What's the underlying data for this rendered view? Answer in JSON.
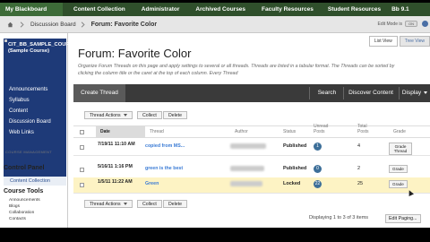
{
  "top_tabs": [
    "My Blackboard",
    "Content Collection",
    "Administrator",
    "Archived Courses",
    "Faculty Resources",
    "Student Resources",
    "Bb 9.1"
  ],
  "breadcrumb": {
    "parent": "Discussion Board",
    "current": "Forum: Favorite Color"
  },
  "edit_mode": {
    "label": "Edit Mode is",
    "state": "ON"
  },
  "view_tabs": [
    "List View",
    "Tree View"
  ],
  "page_title": "Forum: Favorite Color",
  "page_description": "Organize Forum Threads on this page and apply settings to several or all threads. Threads are listed in a tabular format. The Threads can be sorted by clicking the column title or the caret at the top of each column. Every Thread",
  "sidebar": {
    "course_title": "CIT_BB_SAMPLE_COURSE_PERM (Sample Course)",
    "menu": [
      "Announcements",
      "Syllabus",
      "Content",
      "Discussion Board",
      "Web Links"
    ],
    "management_label": "COURSE MANAGEMENT",
    "control_panel": "Control Panel",
    "control_panel_item": "Content Collection",
    "course_tools": "Course Tools",
    "course_tools_items": [
      "Announcements",
      "Blogs",
      "Collaboration",
      "Contacts"
    ]
  },
  "actionbar": {
    "create": "Create Thread",
    "search": "Search",
    "discover": "Discover Content",
    "display": "Display"
  },
  "toolbar": {
    "thread_actions": "Thread Actions",
    "collect": "Collect",
    "delete": "Delete"
  },
  "table": {
    "headers": {
      "date": "Date",
      "thread": "Thread",
      "author": "Author",
      "status": "Status",
      "unread": "Unread Posts",
      "total": "Total Posts",
      "grade": "Grade"
    },
    "rows": [
      {
        "date": "7/19/11 11:10 AM",
        "thread": "copied from MS...",
        "status": "Published",
        "unread": "1",
        "total": "4",
        "grade": "Grade Thread"
      },
      {
        "date": "5/16/11 1:16 PM",
        "thread": "green is the best",
        "status": "Published",
        "unread": "0",
        "total": "2",
        "grade": "Grade"
      },
      {
        "date": "1/5/11 11:22 AM",
        "thread": "Green",
        "status": "Locked",
        "unread": "22",
        "total": "25",
        "grade": "Grade"
      }
    ]
  },
  "footer": {
    "display_info": "Displaying 1 to 3 of 3 items",
    "edit_paging": "Edit Paging..."
  },
  "colors": {
    "topbar": "#2f4f2b",
    "sidebar": "#1e3a78",
    "actionbar": "#3a3a3a",
    "badge": "#3d6f99",
    "highlight": "#fdf3c4"
  }
}
